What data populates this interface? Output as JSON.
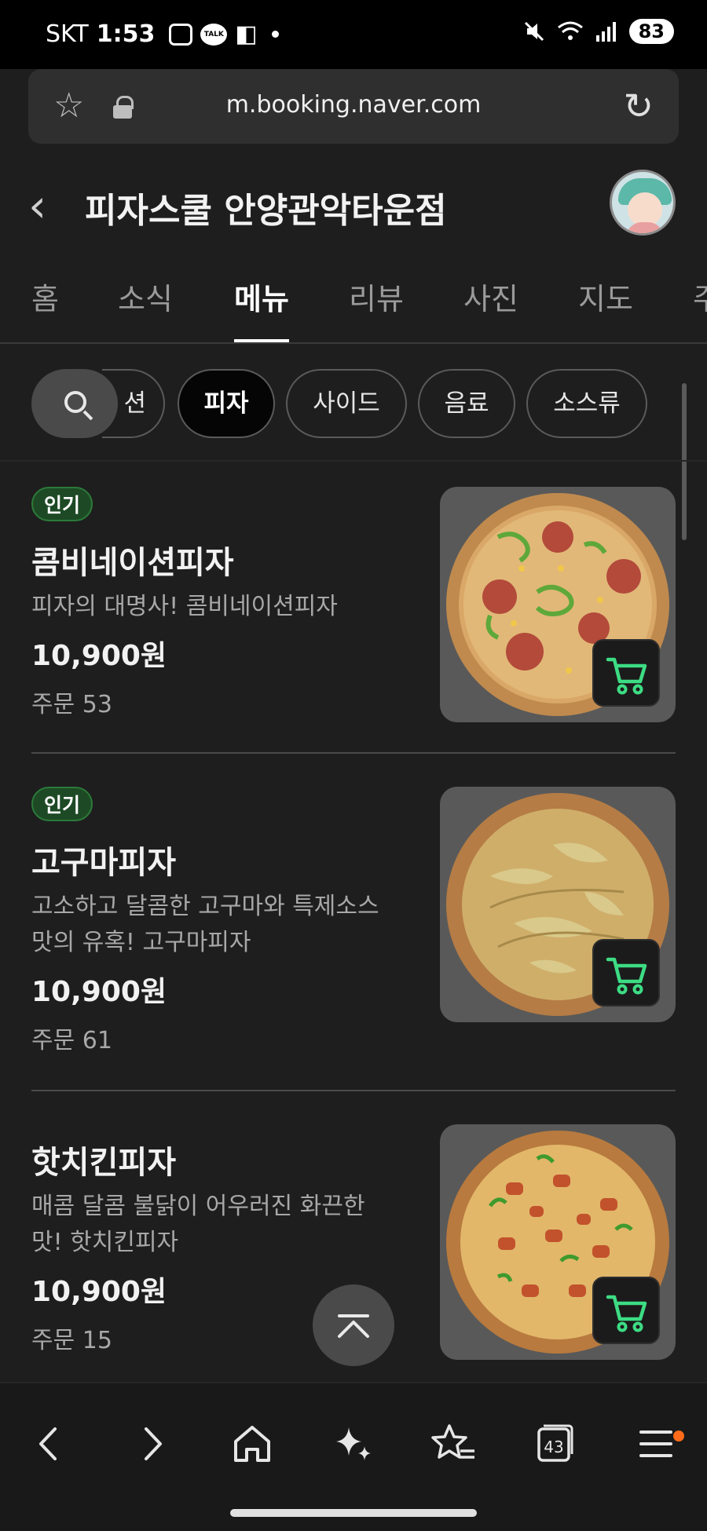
{
  "status_bar": {
    "carrier": "SKT",
    "time": "1:53",
    "talk_label": "TALK",
    "battery": "83"
  },
  "browser": {
    "url": "m.booking.naver.com"
  },
  "header": {
    "title": "피자스쿨 안양관악타운점"
  },
  "tabs": [
    {
      "label": "홈"
    },
    {
      "label": "소식"
    },
    {
      "label": "메뉴",
      "active": true
    },
    {
      "label": "리뷰"
    },
    {
      "label": "사진"
    },
    {
      "label": "지도"
    },
    {
      "label": "주"
    }
  ],
  "categories": [
    {
      "label": "션"
    },
    {
      "label": "피자",
      "active": true
    },
    {
      "label": "사이드"
    },
    {
      "label": "음료"
    },
    {
      "label": "소스류"
    }
  ],
  "menu": [
    {
      "badge": "인기",
      "name": "콤비네이션피자",
      "desc_line1": "피자의 대명사! 콤비네이션피자",
      "desc_line2": "",
      "price": "10,900원",
      "orders": "주문 53",
      "image": "combination-pizza-image"
    },
    {
      "badge": "인기",
      "name": "고구마피자",
      "desc_line1": "고소하고 달콤한 고구마와 특제소스",
      "desc_line2": "맛의 유혹! 고구마피자",
      "price": "10,900원",
      "orders": "주문 61",
      "image": "sweet-potato-pizza-image"
    },
    {
      "badge": "",
      "name": "핫치킨피자",
      "desc_line1": "매콤 달콤 불닭이 어우러진 화끈한",
      "desc_line2": "맛! 핫치킨피자",
      "price": "10,900원",
      "orders": "주문 15",
      "image": "hot-chicken-pizza-image"
    }
  ],
  "bottom_nav": {
    "tabs_count": "43"
  },
  "colors": {
    "background": "#1e1e1e",
    "badge_bg": "#1d4a25",
    "cart_green": "#3ddc84",
    "notification": "#ff6b1a"
  }
}
